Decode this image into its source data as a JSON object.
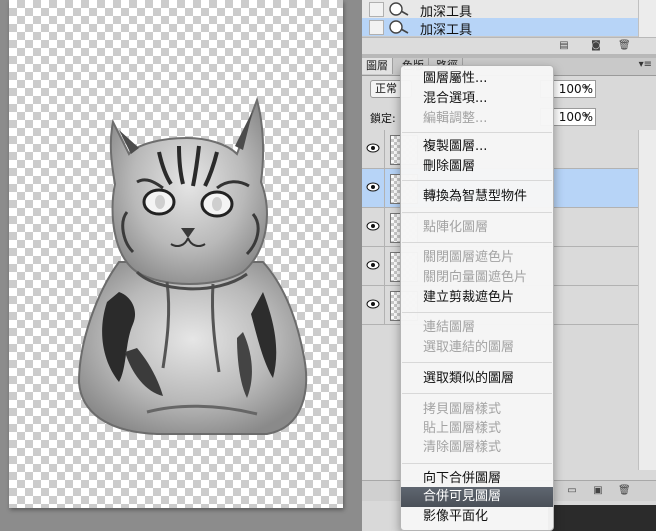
{
  "history": {
    "items": [
      {
        "label": "加深工具",
        "selected": false
      },
      {
        "label": "加深工具",
        "selected": true
      }
    ]
  },
  "layers_panel": {
    "tabs": [
      "圖層",
      "色版",
      "路徑"
    ],
    "blend_mode": "正常",
    "opacity": "100%",
    "lock_label": "鎖定:",
    "fill": "100%"
  },
  "context_menu": {
    "items": [
      {
        "label": "圖層屬性...",
        "state": "enabled"
      },
      {
        "label": "混合選項...",
        "state": "enabled"
      },
      {
        "label": "編輯調整...",
        "state": "disabled"
      },
      {
        "label": "複製圖層...",
        "state": "enabled"
      },
      {
        "label": "刪除圖層",
        "state": "enabled"
      },
      {
        "label": "轉換為智慧型物件",
        "state": "enabled"
      },
      {
        "label": "點陣化圖層",
        "state": "disabled"
      },
      {
        "label": "關閉圖層遮色片",
        "state": "disabled"
      },
      {
        "label": "關閉向量圖遮色片",
        "state": "disabled"
      },
      {
        "label": "建立剪裁遮色片",
        "state": "enabled"
      },
      {
        "label": "連結圖層",
        "state": "disabled"
      },
      {
        "label": "選取連結的圖層",
        "state": "disabled"
      },
      {
        "label": "選取類似的圖層",
        "state": "enabled"
      },
      {
        "label": "拷貝圖層樣式",
        "state": "disabled"
      },
      {
        "label": "貼上圖層樣式",
        "state": "disabled"
      },
      {
        "label": "清除圖層樣式",
        "state": "disabled"
      },
      {
        "label": "向下合併圖層",
        "state": "enabled"
      },
      {
        "label": "合併可見圖層",
        "state": "highlighted"
      },
      {
        "label": "影像平面化",
        "state": "enabled"
      }
    ]
  },
  "colors": {
    "selection_blue": "#b7d4f7",
    "menu_highlight": "#4f565e",
    "disabled_text": "#a3a3a3"
  }
}
